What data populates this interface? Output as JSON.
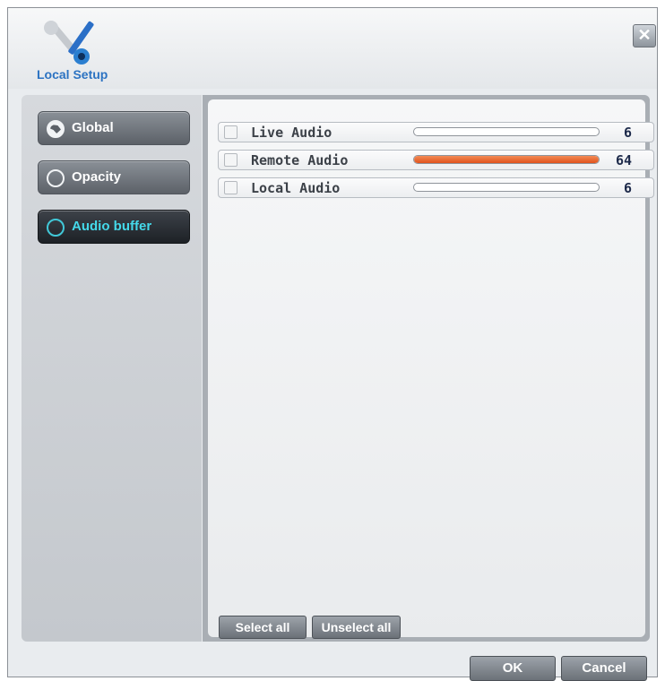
{
  "window": {
    "title": "Local Setup",
    "logo_icon": "wrench-screwdriver-gear-icon",
    "close_icon": "close-icon",
    "close_glyph": "✕"
  },
  "sidebar": {
    "items": [
      {
        "label": "Global",
        "icon": "globe-icon",
        "active": false
      },
      {
        "label": "Opacity",
        "icon": "circle-icon",
        "active": false
      },
      {
        "label": "Audio buffer",
        "icon": "circle-icon",
        "active": true
      }
    ]
  },
  "audio": {
    "rows": [
      {
        "label": "Live Audio",
        "value": "6",
        "checked": false,
        "fill_fraction": 0.0
      },
      {
        "label": "Remote Audio",
        "value": "64",
        "checked": false,
        "fill_fraction": 1.0
      },
      {
        "label": "Local Audio",
        "value": "6",
        "checked": false,
        "fill_fraction": 0.0
      }
    ],
    "select_all": "Select all",
    "unselect_all": "Unselect all"
  },
  "footer": {
    "ok": "OK",
    "cancel": "Cancel"
  },
  "colors": {
    "accent_active": "#45d9ea",
    "slider_fill": "#e8652f",
    "logo_text": "#2c73c2"
  }
}
